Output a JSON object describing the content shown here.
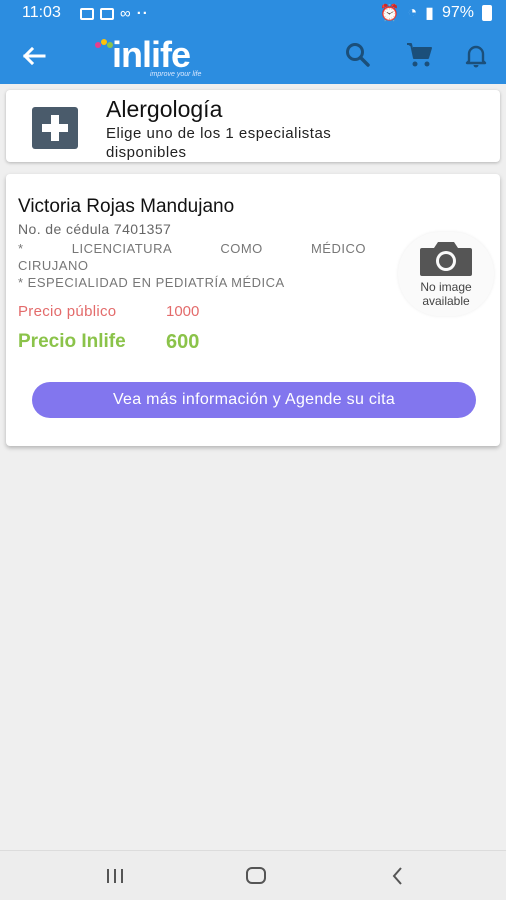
{
  "status_bar": {
    "time": "11:03",
    "battery": "97%"
  },
  "app_bar": {
    "logo_text": "inlife",
    "logo_tagline": "improve your life"
  },
  "header": {
    "title": "Alergología",
    "subtitle": "Elige uno de los 1 especialistas disponibles"
  },
  "doctor": {
    "name": "Victoria Rojas Mandujano",
    "cedula": "No. de cédula 7401357",
    "degree_words": [
      "*",
      "LICENCIATURA",
      "COMO",
      "MÉDICO"
    ],
    "degree_cont": "CIRUJANO",
    "specialty": "* ESPECIALIDAD EN PEDIATRÍA MÉDICA",
    "price_public_label": "Precio público",
    "price_public_value": "1000",
    "price_inlife_label": "Precio Inlife",
    "price_inlife_value": "600",
    "no_image_line1": "No image",
    "no_image_line2": "available",
    "cta_label": "Vea más información y Agende su cita"
  },
  "colors": {
    "primary": "#2c8de0",
    "cta": "#8276ee",
    "price_public": "#e36b6b",
    "price_inlife": "#8bc34a"
  }
}
